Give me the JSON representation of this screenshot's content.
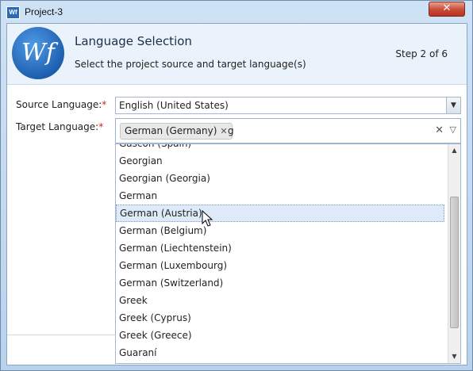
{
  "window": {
    "title": "Project-3",
    "icon": "wf-app-icon",
    "close_label": "✕"
  },
  "header": {
    "logo_text": "Wf",
    "title": "Language Selection",
    "subtitle": "Select the project source and target language(s)",
    "step": "Step 2 of 6"
  },
  "form": {
    "source_label": "Source Language:",
    "source_value": "English (United States)",
    "target_label": "Target Language:",
    "required_mark": "*",
    "target_chip": "German (Germany)",
    "chip_remove": "✕",
    "typed_text": "g"
  },
  "dropdown": {
    "items": [
      "Gascon (Spain)",
      "Georgian",
      "Georgian (Georgia)",
      "German",
      "German (Austria)",
      "German (Belgium)",
      "German (Liechtenstein)",
      "German (Luxembourg)",
      "German (Switzerland)",
      "Greek",
      "Greek (Cyprus)",
      "Greek (Greece)",
      "Guaraní"
    ],
    "highlighted": "German (Austria)"
  },
  "icons": {
    "clear": "clear-icon",
    "expand": "expand-icon",
    "cursor": "mouse-cursor-icon"
  },
  "colors": {
    "accent": "#1f5fb0",
    "required": "#cc2222",
    "highlight": "#dfeaf8"
  }
}
